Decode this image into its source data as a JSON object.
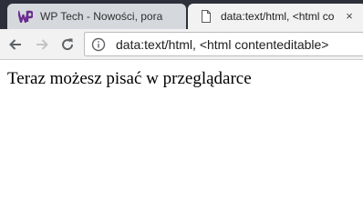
{
  "tabs": [
    {
      "title": "WP Tech - Nowości, pora",
      "active": false,
      "favicon": "wp-logo-icon",
      "favicon_color": "#6b2d8f"
    },
    {
      "title": "data:text/html, <html co",
      "active": true,
      "favicon": "document-icon",
      "close_label": "×"
    }
  ],
  "toolbar": {
    "back": "back-arrow-icon",
    "forward": "forward-arrow-icon",
    "reload": "reload-icon"
  },
  "omnibox": {
    "security_icon": "info-icon",
    "url": "data:text/html, <html contenteditable>"
  },
  "page": {
    "text": "Teraz możesz pisać w przeglądarce"
  },
  "colors": {
    "tabstrip": "#2d2f3a",
    "active_tab": "#f2f2f2",
    "inactive_tab": "#d5d8dd",
    "toolbar": "#f2f2f2"
  }
}
